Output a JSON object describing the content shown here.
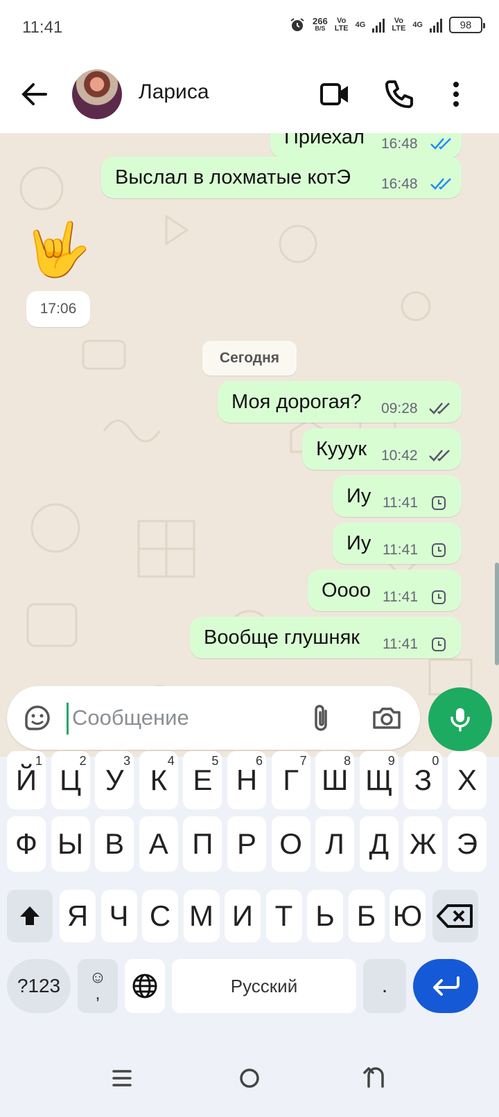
{
  "status_bar": {
    "time": "11:41",
    "net_speed_value": "266",
    "net_speed_unit": "B/S",
    "sim1_label_top": "Vo",
    "sim1_label_bottom": "LTE",
    "sim1_network": "4G",
    "sim2_label_top": "Vo",
    "sim2_label_bottom": "LTE",
    "sim2_network": "4G",
    "battery": "98"
  },
  "header": {
    "contact_name": "Лариса",
    "icons": [
      "back-arrow-icon",
      "video-call-icon",
      "phone-icon",
      "more-vert-icon"
    ]
  },
  "messages": [
    {
      "dir": "out",
      "text": "Приехал",
      "time": "16:48",
      "status": "read"
    },
    {
      "dir": "out",
      "text": "Выслал в лохматые котЭ",
      "time": "16:48",
      "status": "read"
    },
    {
      "dir": "in",
      "text": "🤟",
      "time": "17:06"
    },
    {
      "date_chip": "Сегодня"
    },
    {
      "dir": "out",
      "text": "Моя дорогая?",
      "time": "09:28",
      "status": "delivered"
    },
    {
      "dir": "out",
      "text": "Кууук",
      "time": "10:42",
      "status": "delivered"
    },
    {
      "dir": "out",
      "text": "Иу",
      "time": "11:41",
      "status": "pending"
    },
    {
      "dir": "out",
      "text": "Иу",
      "time": "11:41",
      "status": "pending"
    },
    {
      "dir": "out",
      "text": "Оооо",
      "time": "11:41",
      "status": "pending"
    },
    {
      "dir": "out",
      "text": "Вообще глушняк",
      "time": "11:41",
      "status": "pending"
    }
  ],
  "colors": {
    "outgoing_bubble": "#d9fdd3",
    "read_tick": "#1f8ef1",
    "chat_background": "#efe7dc",
    "accent_green": "#1daa61",
    "enter_key": "#1659d6"
  },
  "composer": {
    "placeholder": "Сообщение",
    "icons": [
      "sticker-icon",
      "attach-icon",
      "camera-icon",
      "mic-icon"
    ]
  },
  "keyboard": {
    "row1": [
      {
        "k": "Й",
        "h": "1"
      },
      {
        "k": "Ц",
        "h": "2"
      },
      {
        "k": "У",
        "h": "3"
      },
      {
        "k": "К",
        "h": "4"
      },
      {
        "k": "Е",
        "h": "5"
      },
      {
        "k": "Н",
        "h": "6"
      },
      {
        "k": "Г",
        "h": "7"
      },
      {
        "k": "Ш",
        "h": "8"
      },
      {
        "k": "Щ",
        "h": "9"
      },
      {
        "k": "З",
        "h": "0"
      },
      {
        "k": "Х",
        "h": ""
      }
    ],
    "row2": [
      "Ф",
      "Ы",
      "В",
      "А",
      "П",
      "Р",
      "О",
      "Л",
      "Д",
      "Ж",
      "Э"
    ],
    "row3": [
      "Я",
      "Ч",
      "С",
      "М",
      "И",
      "Т",
      "Ь",
      "Б",
      "Ю"
    ],
    "symbols_key": "?123",
    "emoji_key_top": "☺",
    "emoji_key_bottom": ",",
    "space_label": "Русский",
    "period_key": ".",
    "icons": [
      "shift-icon",
      "backspace-icon",
      "globe-icon",
      "enter-icon"
    ]
  },
  "nav_bar": {
    "icons": [
      "recents-icon",
      "home-icon",
      "back-icon"
    ]
  }
}
